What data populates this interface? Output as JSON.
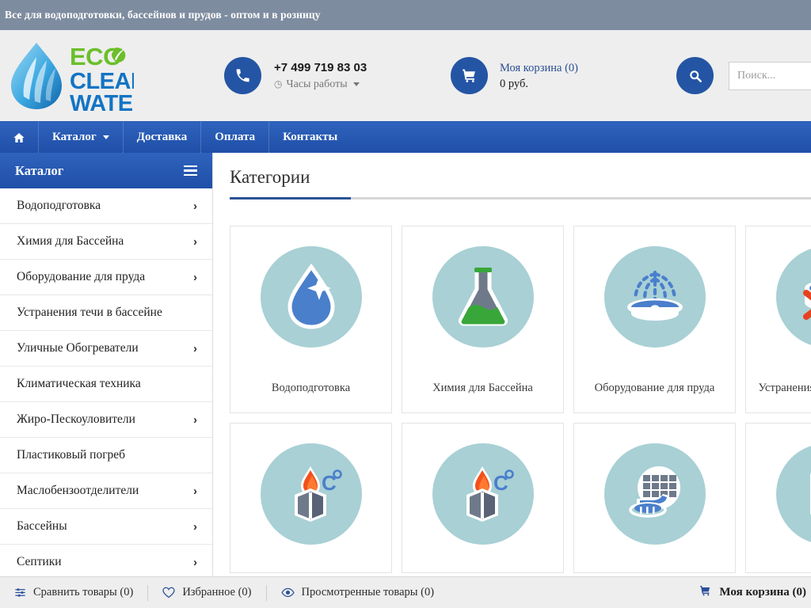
{
  "topbar": {
    "slogan": "Все для водоподготовки, бассейнов и прудов - оптом и в розницу"
  },
  "header": {
    "logo": {
      "line1": "ECO",
      "line2": "CLEAR",
      "line3": "WATER",
      "alt": "eco-clear-water-logo"
    },
    "phone": {
      "number": "+7 499 719 83 03",
      "hours_label": "Часы работы"
    },
    "cart": {
      "title": "Моя корзина (0)",
      "total": "0 руб."
    },
    "search": {
      "placeholder": "Поиск...",
      "value": ""
    }
  },
  "mainnav": {
    "home_label": "",
    "items": [
      {
        "label": "Каталог",
        "has_caret": true
      },
      {
        "label": "Доставка",
        "has_caret": false
      },
      {
        "label": "Оплата",
        "has_caret": false
      },
      {
        "label": "Контакты",
        "has_caret": false
      }
    ]
  },
  "sidebar": {
    "title": "Каталог",
    "items": [
      {
        "label": "Водоподготовка",
        "chevron": "›"
      },
      {
        "label": "Химия для Бассейна",
        "chevron": "›"
      },
      {
        "label": "Оборудование для пруда",
        "chevron": "›"
      },
      {
        "label": "Устранения течи в бассейне",
        "chevron": ""
      },
      {
        "label": "Уличные Обогреватели",
        "chevron": "›"
      },
      {
        "label": "Климатическая техника",
        "chevron": ""
      },
      {
        "label": "Жиро-Пескоуловители",
        "chevron": "›"
      },
      {
        "label": "Пластиковый погреб",
        "chevron": ""
      },
      {
        "label": "Маслобензоотделители",
        "chevron": "›"
      },
      {
        "label": "Бассейны",
        "chevron": "›"
      },
      {
        "label": "Септики",
        "chevron": "›"
      }
    ]
  },
  "main": {
    "page_title": "Категории",
    "row1": [
      {
        "label": "Водоподготовка",
        "icon": "water-drop-icon"
      },
      {
        "label": "Химия для Бассейна",
        "icon": "flask-icon"
      },
      {
        "label": "Оборудование для пруда",
        "icon": "fountain-icon"
      },
      {
        "label": "Устранения течи в бассейне",
        "icon": "leak-repair-icon"
      }
    ],
    "row2": [
      {
        "label": "",
        "icon": "heater-flame-icon"
      },
      {
        "label": "",
        "icon": "heater-flame-icon"
      },
      {
        "label": "",
        "icon": "grease-trap-icon"
      },
      {
        "label": "",
        "icon": "separator-tank-icon"
      }
    ]
  },
  "bottombar": {
    "compare": "Сравнить товары (0)",
    "favorites": "Избранное (0)",
    "viewed": "Просмотренные товары (0)",
    "cart": "Моя корзина (0)"
  },
  "colors": {
    "topbar_bg": "#7e8ca0",
    "header_bg": "#eeeeee",
    "nav_blue": "#2455a4",
    "accent_blue": "#2a5396",
    "icon_circle": "#a8d0d5",
    "icon_blue": "#4a7fcc",
    "icon_green": "#39a63a",
    "icon_gray": "#6e7a8a",
    "icon_red": "#e8411f",
    "link_blue": "#2b4e92"
  }
}
